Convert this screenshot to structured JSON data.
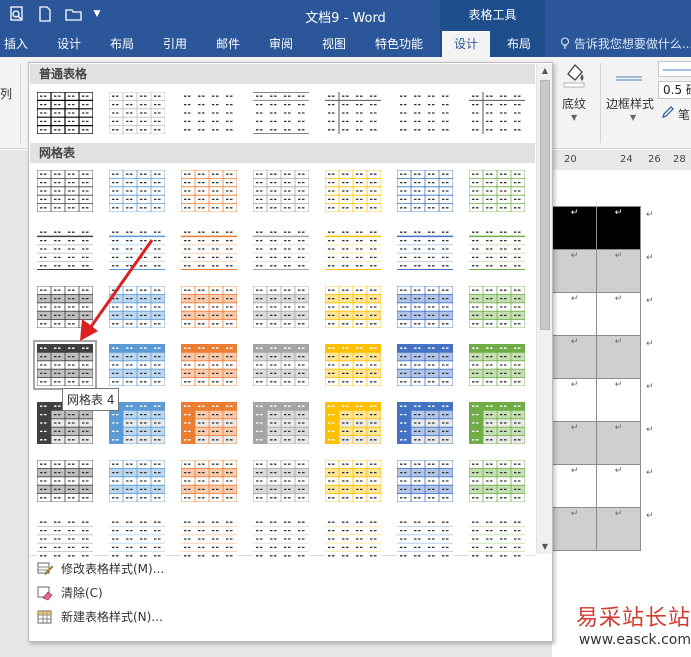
{
  "window": {
    "doc_title": "文档9 - Word",
    "context_title": "表格工具"
  },
  "tabs": [
    {
      "label": "插入",
      "active": false
    },
    {
      "label": "设计",
      "active": false
    },
    {
      "label": "布局",
      "active": false
    },
    {
      "label": "引用",
      "active": false
    },
    {
      "label": "邮件",
      "active": false
    },
    {
      "label": "审阅",
      "active": false
    },
    {
      "label": "视图",
      "active": false
    },
    {
      "label": "特色功能",
      "active": false
    },
    {
      "label": "设计",
      "active": true
    },
    {
      "label": "布局",
      "active": false
    }
  ],
  "tellme": "告诉我您想要做什么...",
  "ribbon": {
    "col_label": "列",
    "shading_label": "底纹",
    "border_style_label": "边框样式",
    "pen_width": "0.5 磅",
    "pen_label": "笔"
  },
  "ruler": {
    "ticks": [
      "20",
      "24",
      "26",
      "28"
    ]
  },
  "gallery": {
    "section_plain": "普通表格",
    "section_grid": "网格表",
    "tooltip": "网格表 4",
    "selected_style": "网格表 4"
  },
  "styles": {
    "colors": [
      "#404040",
      "#5b9bd5",
      "#ed7d31",
      "#a5a5a5",
      "#ffc000",
      "#4472c4",
      "#70ad47"
    ],
    "light_colors": [
      "#bfbfbf",
      "#bdd7ee",
      "#f8cbad",
      "#dbdbdb",
      "#ffe699",
      "#b4c6e7",
      "#c5e0b3"
    ]
  },
  "menu": {
    "modify": "修改表格样式(M)...",
    "clear": "清除(C)",
    "new_style": "新建表格样式(N)..."
  },
  "watermark": {
    "cn": "易采站长站",
    "url": "www.easck.com"
  }
}
